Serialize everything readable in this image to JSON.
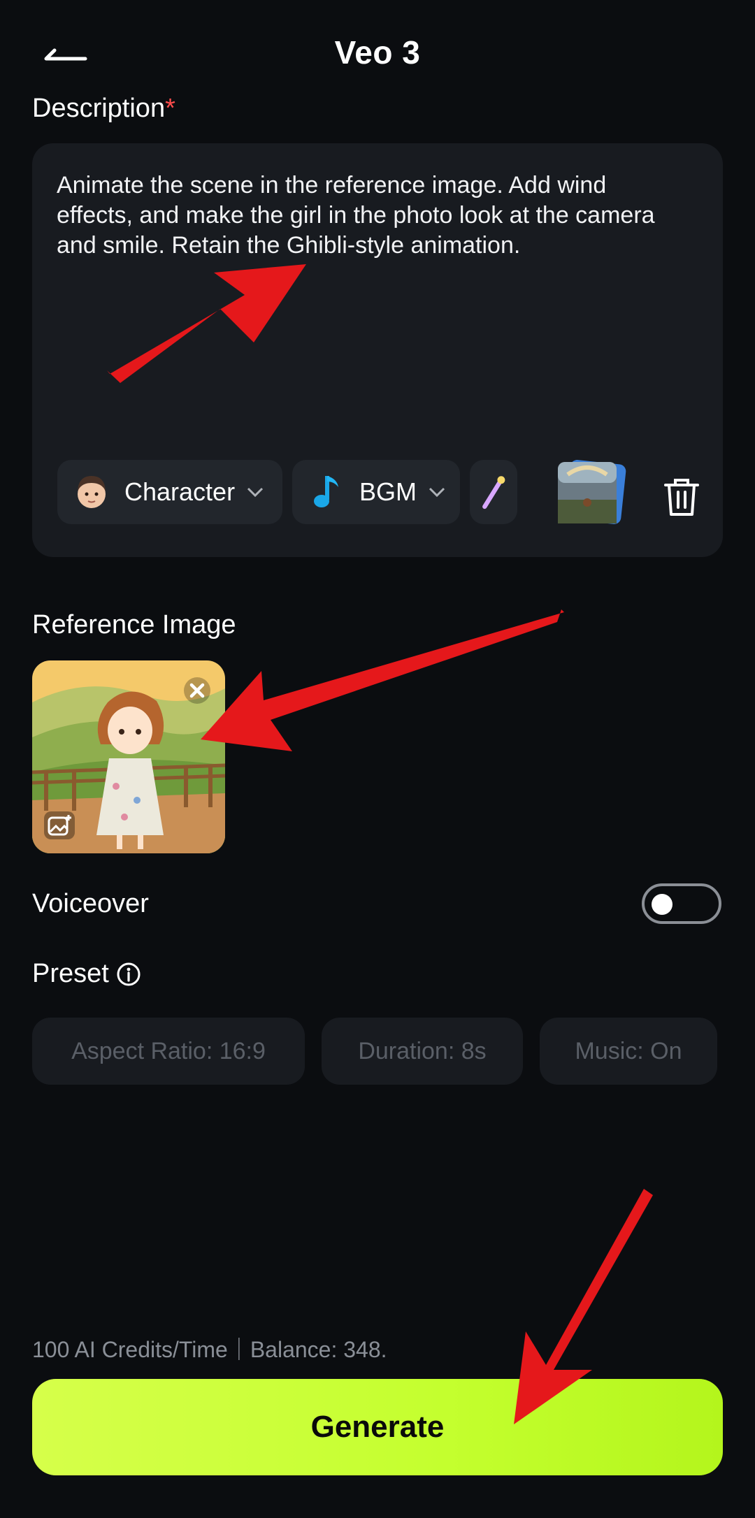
{
  "header": {
    "title": "Veo 3",
    "back_icon": "back-arrow-icon"
  },
  "description": {
    "label": "Description",
    "required_mark": "*",
    "text": "Animate the scene in the reference image. Add wind effects, and make the girl in the photo look at the camera and smile. Retain the Ghibli-style animation.",
    "chips": [
      {
        "label": "Character",
        "icon": "character-face-icon"
      },
      {
        "label": "BGM",
        "icon": "music-note-icon"
      },
      {
        "label": "",
        "icon": "magic-wand-icon"
      }
    ]
  },
  "reference_image": {
    "label": "Reference Image"
  },
  "voiceover": {
    "label": "Voiceover",
    "enabled": false
  },
  "preset": {
    "label": "Preset",
    "items": [
      "Aspect Ratio: 16:9",
      "Duration: 8s",
      "Music: On"
    ]
  },
  "footer": {
    "credits_text": "100 AI Credits/Time｜Balance: 348.",
    "generate_label": "Generate"
  },
  "colors": {
    "background": "#0b0d10",
    "card": "#181b20",
    "accent": "#c4ff2e",
    "required": "#ff4d4d",
    "annotation_arrow": "#e5181b"
  }
}
